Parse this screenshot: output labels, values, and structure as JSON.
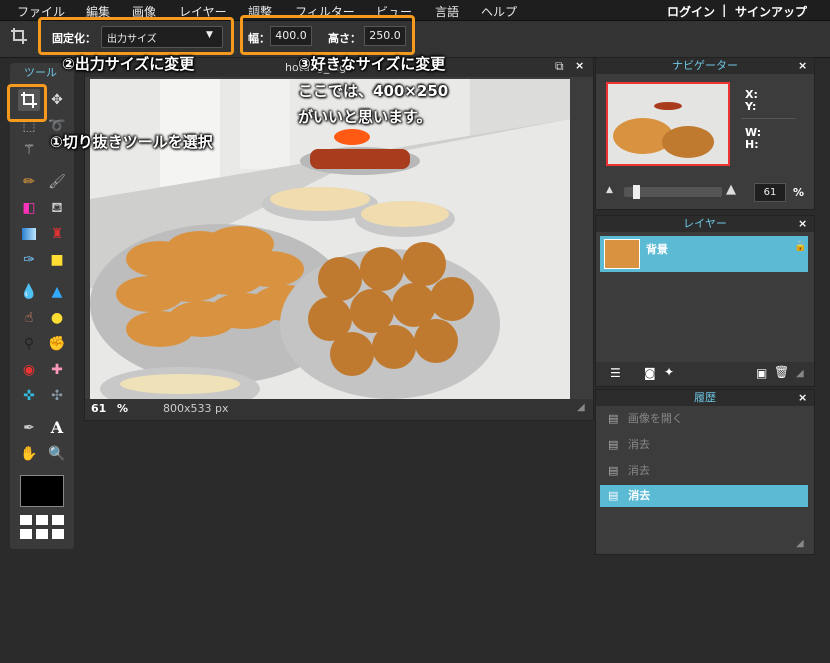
{
  "menu": {
    "items": [
      "ファイル",
      "編集",
      "画像",
      "レイヤー",
      "調整",
      "フィルター",
      "ビュー",
      "言語",
      "ヘルプ"
    ],
    "login": "ログイン",
    "separator": "|",
    "signup": "サインアップ"
  },
  "options": {
    "fixed_label": "固定化：",
    "fixed_value": "出力サイズ",
    "width_label": "幅：",
    "width_value": "400.0",
    "height_label": "高さ：",
    "height_value": "250.0"
  },
  "annotations": {
    "step1": "①切り抜きツールを選択",
    "step2": "②出力サイズに変更",
    "step3_line1": "③好きなサイズに変更",
    "step3_line2": "ここでは、400×250",
    "step3_line3": "がいいと思います。",
    "highlight_color": "#f59a1c"
  },
  "tools": {
    "title": "ツール",
    "icons": [
      "crop-icon",
      "move-icon",
      "marquee-icon",
      "lasso-icon",
      "wand-icon",
      "pencil-icon",
      "brush-icon",
      "eraser-icon",
      "bucket-icon",
      "gradient-icon",
      "stamp-icon",
      "color-replace-icon",
      "shape-icon",
      "blur-icon",
      "sharpen-icon",
      "smudge-icon",
      "sponge-icon",
      "dodge-icon",
      "burn-icon",
      "redeye-icon",
      "spotheal-icon",
      "bloat-icon",
      "pinch-icon",
      "picker-icon",
      "text-icon",
      "hand-icon",
      "zoom-icon"
    ],
    "primary_color": "#000000"
  },
  "document": {
    "title": "hotdog_big",
    "zoom": "61",
    "zoom_unit": "%",
    "size": "800x533 px"
  },
  "navigator": {
    "title": "ナビゲーター",
    "x_label": "X:",
    "y_label": "Y:",
    "w_label": "W:",
    "h_label": "H:",
    "zoom": "61",
    "zoom_unit": "%",
    "zoom_fraction": 0.1
  },
  "layers": {
    "title": "レイヤー",
    "items": [
      {
        "name": "背景",
        "selected": true
      }
    ]
  },
  "history": {
    "title": "履歴",
    "items": [
      {
        "label": "画像を開く",
        "selected": false
      },
      {
        "label": "消去",
        "selected": false
      },
      {
        "label": "消去",
        "selected": false
      },
      {
        "label": "消去",
        "selected": true
      }
    ]
  },
  "close_glyph": "×"
}
